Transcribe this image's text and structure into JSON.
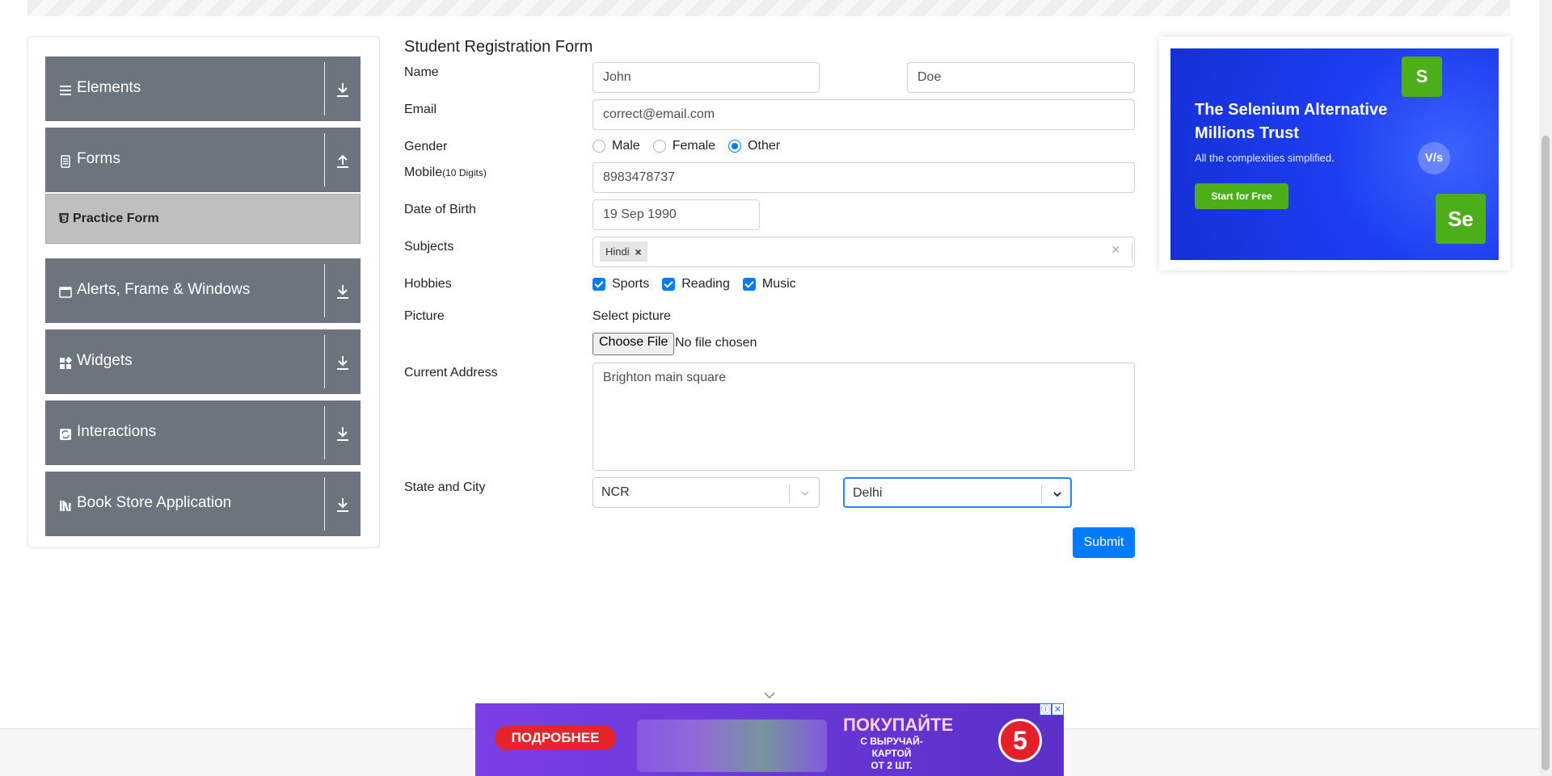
{
  "sidebar": {
    "groups": [
      {
        "label": "Elements",
        "icon": "hamburger-icon",
        "arrow": "download-icon"
      },
      {
        "label": "Forms",
        "icon": "document-icon",
        "arrow": "upload-icon"
      },
      {
        "label": "Alerts, Frame & Windows",
        "icon": "window-icon",
        "arrow": "download-icon"
      },
      {
        "label": "Widgets",
        "icon": "widgets-icon",
        "arrow": "download-icon"
      },
      {
        "label": "Interactions",
        "icon": "interactions-icon",
        "arrow": "download-icon"
      },
      {
        "label": "Book Store Application",
        "icon": "books-icon",
        "arrow": "download-icon"
      }
    ],
    "active_item": "Practice Form"
  },
  "form": {
    "title": "Student Registration Form",
    "labels": {
      "name": "Name",
      "email": "Email",
      "gender": "Gender",
      "mobile": "Mobile",
      "mobile_hint": "(10 Digits)",
      "dob": "Date of Birth",
      "subjects": "Subjects",
      "hobbies": "Hobbies",
      "picture": "Picture",
      "address": "Current Address",
      "state_city": "State and City"
    },
    "first_name": "John",
    "last_name": "Doe",
    "email": "correct@email.com",
    "gender_options": [
      "Male",
      "Female",
      "Other"
    ],
    "gender_selected": "Other",
    "mobile": "8983478737",
    "dob": "19 Sep 1990",
    "subjects": [
      "Hindi"
    ],
    "subject_remove": "×",
    "subjects_clear": "×",
    "hobbies": [
      "Sports",
      "Reading",
      "Music"
    ],
    "hobbies_checked": [
      "Sports",
      "Reading",
      "Music"
    ],
    "picture_prompt": "Select picture",
    "file_button": "Choose File",
    "file_status": "No file chosen",
    "address": "Brighton main square",
    "state": "NCR",
    "city": "Delhi",
    "submit": "Submit"
  },
  "ad_right": {
    "headline": "The Selenium Alternative Millions Trust",
    "subline": "All the complexities simplified.",
    "cta": "Start for Free",
    "badge_s": "S",
    "badge_se": "Se",
    "vs": "V/s"
  },
  "ad_bottom": {
    "more": "ПОДРОБНЕЕ",
    "buy": "ПОКУПАЙТЕ",
    "buy_sub": "С ВЫРУЧАЙ-КАРТОЙ",
    "buy_qty": "ОТ 2 ШТ.",
    "logo": "5",
    "info": "ⓘ",
    "close": "✕"
  },
  "colors": {
    "sidebar_group": "#6c757d",
    "active_item": "#bfbfbf",
    "primary": "#007bff",
    "ad_green": "#4caf1a",
    "ad_purple": "#6a38d8"
  }
}
